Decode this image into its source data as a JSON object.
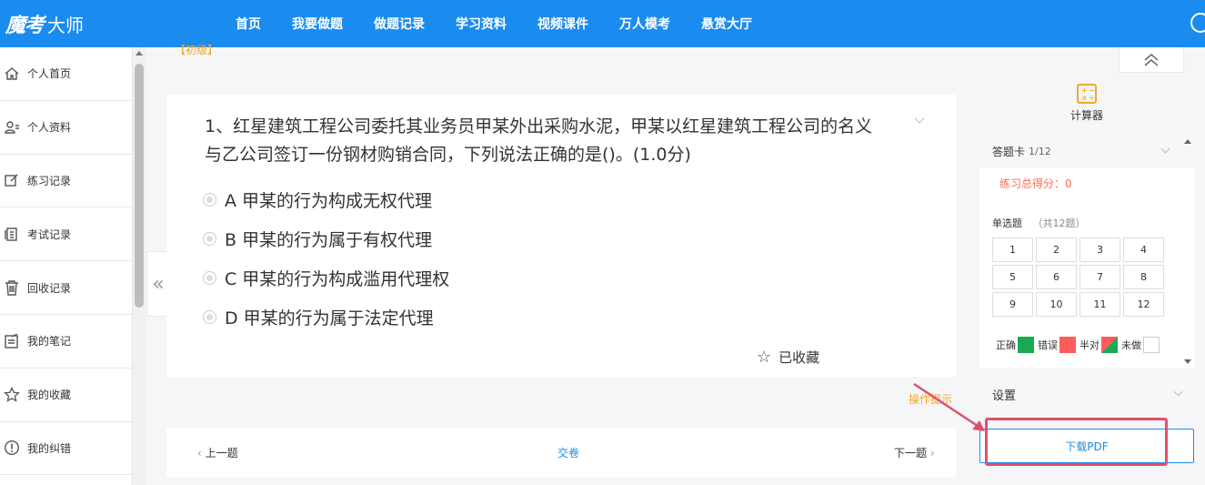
{
  "brand": {
    "mark": "魔考",
    "name": "大师"
  },
  "nav": [
    "首页",
    "我要做题",
    "做题记录",
    "学习资料",
    "视频课件",
    "万人模考",
    "悬赏大厅"
  ],
  "sidebar": [
    {
      "label": "个人首页",
      "icon": "home-icon"
    },
    {
      "label": "个人资料",
      "icon": "user-card-icon"
    },
    {
      "label": "练习记录",
      "icon": "edit-icon"
    },
    {
      "label": "考试记录",
      "icon": "document-icon"
    },
    {
      "label": "回收记录",
      "icon": "trash-icon"
    },
    {
      "label": "我的笔记",
      "icon": "note-icon"
    },
    {
      "label": "我的收藏",
      "icon": "star-icon"
    },
    {
      "label": "我的纠错",
      "icon": "alert-icon"
    }
  ],
  "question": {
    "tag": "【初级】",
    "title": "1、红星建筑工程公司委托其业务员甲某外出采购水泥，甲某以红星建筑工程公司的名义与乙公司签订一份钢材购销合同，下列说法正确的是()。(1.0分)",
    "options": [
      "A 甲某的行为构成无权代理",
      "B 甲某的行为属于有权代理",
      "C 甲某的行为构成滥用代理权",
      "D 甲某的行为属于法定代理"
    ],
    "favorite_label": "已收藏"
  },
  "hint": "操作提示",
  "footer": {
    "prev": "上一题",
    "submit": "交卷",
    "next": "下一题"
  },
  "calculator": {
    "label": "计算器"
  },
  "answer_card": {
    "title": "答题卡",
    "count": "1/12",
    "score_label": "练习总得分：0",
    "section": "单选题",
    "section_total": "（共12题）",
    "numbers": [
      "1",
      "2",
      "3",
      "4",
      "5",
      "6",
      "7",
      "8",
      "9",
      "10",
      "11",
      "12"
    ],
    "legend": [
      {
        "label": "正确",
        "color": "#1aaa55"
      },
      {
        "label": "错误",
        "color": "#ff5b5b"
      },
      {
        "label": "半对",
        "color": "split"
      },
      {
        "label": "未做",
        "color": "#ffffff"
      }
    ]
  },
  "settings": {
    "label": "设置"
  },
  "download": {
    "label": "下载PDF"
  },
  "colors": {
    "primary": "#1a8cf0",
    "accent": "#f5a623",
    "highlight": "#e0506a"
  }
}
